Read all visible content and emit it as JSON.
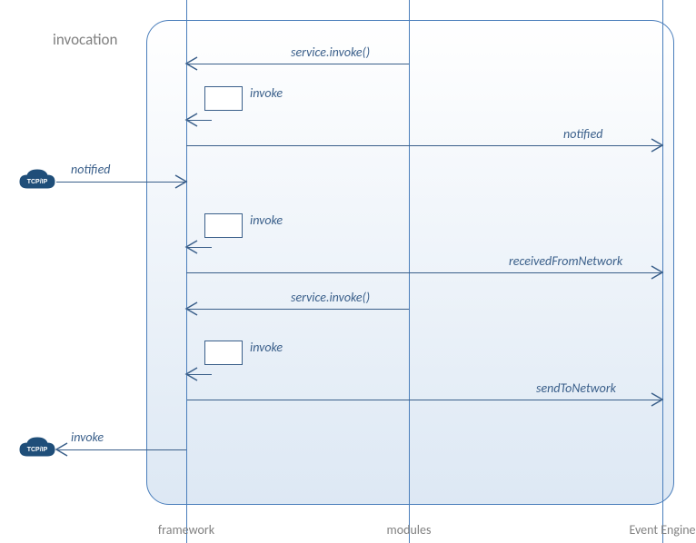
{
  "title": "invocation",
  "lifelines": {
    "framework_label": "framework",
    "modules_label": "modules",
    "event_engine_label": "Event Engine"
  },
  "icons": {
    "tcp_upper": "TCP/IP",
    "tcp_lower": "TCP/IP"
  },
  "external": {
    "notified_in": "notified",
    "invoke_out": "invoke"
  },
  "arrows": {
    "a1_service_invoke_1": "service.invoke()",
    "a2_self_invoke_1": "invoke",
    "a3_notified": "notified",
    "a4_self_invoke_2": "invoke",
    "a5_received": "receivedFromNetwork",
    "a6_service_invoke_2": "service.invoke()",
    "a7_self_invoke_3": "invoke",
    "a8_send": "sendToNetwork"
  }
}
